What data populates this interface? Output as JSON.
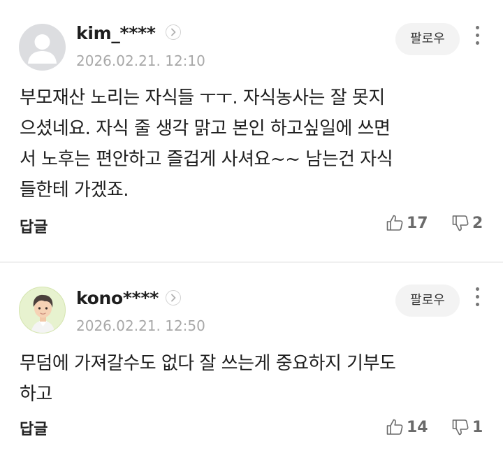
{
  "comments": [
    {
      "nickname": "kim_****",
      "avatar": "default-profile-icon",
      "date": "2026.02.21. 12:10",
      "follow_label": "팔로우",
      "body": "부모재산 노리는 자식들 ㅜㅜ. 자식농사는 잘 못지\n으셨네요. 자식 줄 생각 맑고 본인 하고싶일에 쓰면\n서 노후는 편안하고 즐겁게 사셔요~~ 남는건 자식\n들한테 가겠죠.",
      "reply_label": "답글",
      "likes": "17",
      "dislikes": "2"
    },
    {
      "nickname": "kono****",
      "avatar": "character-avatar",
      "date": "2026.02.21. 12:50",
      "follow_label": "팔로우",
      "body": "무덤에 가져갈수도 없다 잘 쓰는게 중요하지 기부도\n하고",
      "reply_label": "답글",
      "likes": "14",
      "dislikes": "1"
    }
  ],
  "icons": {
    "chevron": "chevron-right-icon",
    "more": "more-vertical-icon",
    "like": "thumbs-up-icon",
    "dislike": "thumbs-down-icon"
  },
  "colors": {
    "text": "#1e1e1e",
    "meta": "#a8a8a8",
    "follow_bg": "#f3f3f3",
    "icon": "#6a6a6a"
  }
}
